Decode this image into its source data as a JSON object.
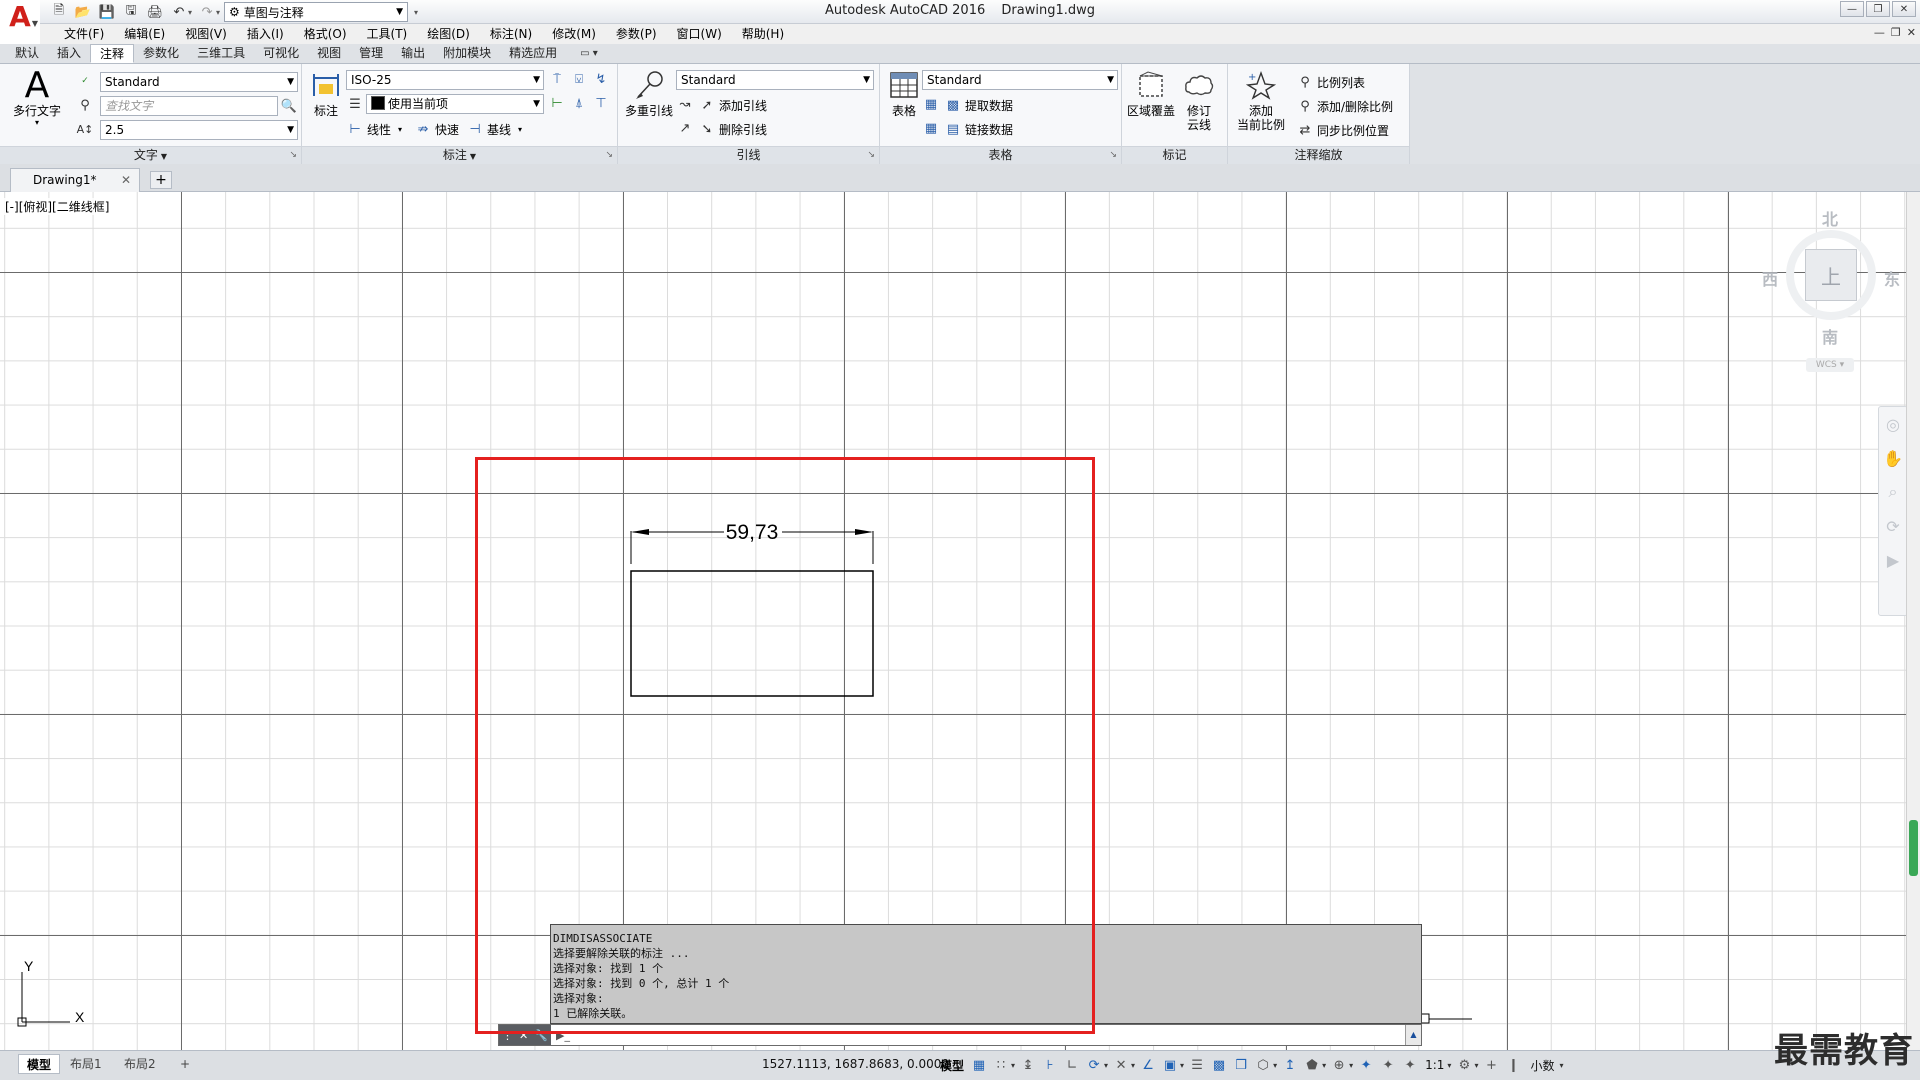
{
  "app": {
    "title": "Autodesk AutoCAD 2016",
    "document": "Drawing1.dwg",
    "workspace": "草图与注释"
  },
  "menu": [
    "文件(F)",
    "编辑(E)",
    "视图(V)",
    "插入(I)",
    "格式(O)",
    "工具(T)",
    "绘图(D)",
    "标注(N)",
    "修改(M)",
    "参数(P)",
    "窗口(W)",
    "帮助(H)"
  ],
  "ribbon_tabs": [
    "默认",
    "插入",
    "注释",
    "参数化",
    "三维工具",
    "可视化",
    "视图",
    "管理",
    "输出",
    "附加模块",
    "精选应用"
  ],
  "ribbon_active_tab": "注释",
  "panels": {
    "text": {
      "title": "文字",
      "big_button": "多行文字",
      "style_value": "Standard",
      "find_placeholder": "查找文字",
      "height_value": "2.5"
    },
    "dimension": {
      "title": "标注",
      "big_button": "标注",
      "style_value": "ISO-25",
      "layer_value": "使用当前项",
      "linear_label": "线性",
      "quick_label": "快速",
      "baseline_label": "基线"
    },
    "leader": {
      "title": "引线",
      "big_button": "多重引线",
      "style_value": "Standard",
      "add_label": "添加引线",
      "remove_label": "删除引线"
    },
    "table": {
      "title": "表格",
      "big_button": "表格",
      "style_value": "Standard",
      "extract_label": "提取数据",
      "link_label": "链接数据"
    },
    "markup": {
      "title": "标记",
      "wipeout_label": "区域覆盖",
      "revcloud_line1": "修订",
      "revcloud_line2": "云线"
    },
    "annoscale": {
      "title": "注释缩放",
      "add_line1": "添加",
      "add_line2": "当前比例",
      "scale_list": "比例列表",
      "add_delete": "添加/删除比例",
      "sync": "同步比例位置"
    }
  },
  "doc_tab": "Drawing1*",
  "viewport_label": "[-][俯视][二维线框]",
  "viewcube": {
    "north": "北",
    "south": "南",
    "east": "东",
    "west": "西",
    "top": "上",
    "wcs": "WCS"
  },
  "dimension_text": "59,73",
  "ucs": {
    "x": "X",
    "y": "Y"
  },
  "command_history": [
    "DIMDISASSOCIATE",
    "选择要解除关联的标注 ...",
    "选择对象: 找到 1 个",
    "选择对象: 找到 0 个, 总计 1 个",
    "选择对象:",
    "1 已解除关联。"
  ],
  "layout_tabs": [
    "模型",
    "布局1",
    "布局2"
  ],
  "status": {
    "coords": "1527.1113, 1687.8683, 0.0000",
    "model": "模型",
    "scale": "1:1",
    "units": "小数"
  },
  "watermark": "最需教育",
  "colors": {
    "highlight": "#e4201f",
    "brand_red": "#d0201a",
    "accent_blue": "#1f62b5"
  }
}
